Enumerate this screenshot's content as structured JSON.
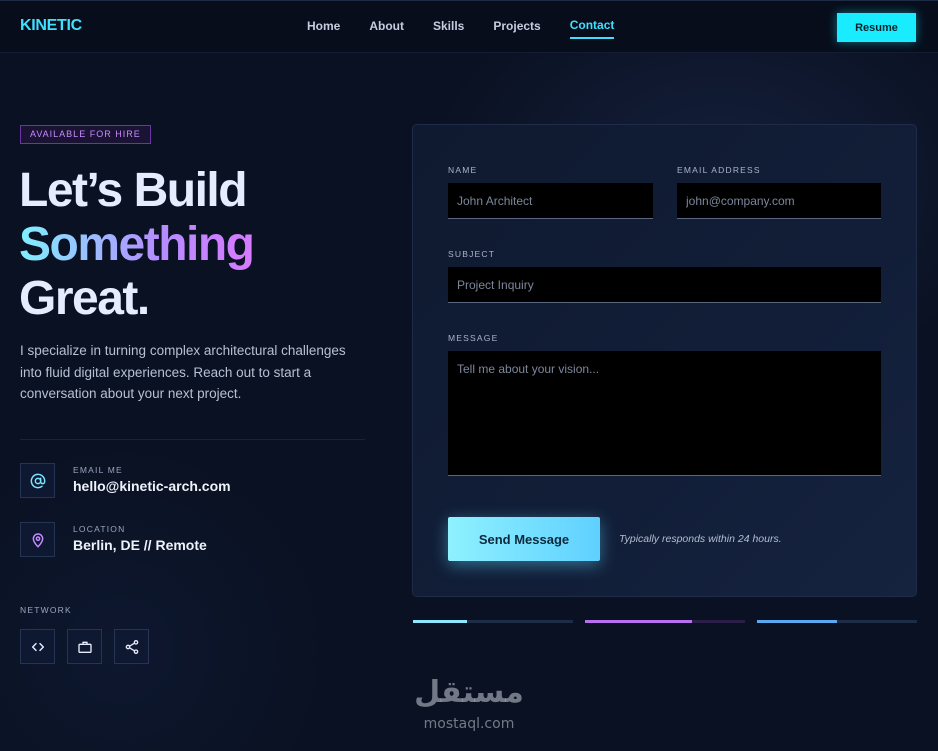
{
  "brand": {
    "logo": "KINETIC"
  },
  "nav": {
    "links": [
      "Home",
      "About",
      "Skills",
      "Projects",
      "Contact"
    ],
    "active": "Contact",
    "resume_label": "Resume"
  },
  "hero": {
    "badge": "AVAILABLE FOR HIRE",
    "line1": "Let’s Build",
    "line2": "Something",
    "line3": "Great.",
    "intro": "I specialize in turning complex architectural challenges into fluid digital experiences. Reach out to start a conversation about your next project."
  },
  "contact": {
    "email": {
      "label": "EMAIL ME",
      "value": "hello@kinetic-arch.com",
      "icon": "at-icon"
    },
    "location": {
      "label": "LOCATION",
      "value": "Berlin, DE // Remote",
      "icon": "map-pin-icon"
    },
    "network_label": "NETWORK",
    "social_icons": [
      "code-icon",
      "briefcase-icon",
      "share-icon"
    ]
  },
  "form": {
    "name": {
      "label": "NAME",
      "placeholder": "John Architect"
    },
    "email": {
      "label": "EMAIL ADDRESS",
      "placeholder": "john@company.com"
    },
    "subject": {
      "label": "SUBJECT",
      "placeholder": "Project Inquiry"
    },
    "message": {
      "label": "MESSAGE",
      "placeholder": "Tell me about your vision..."
    },
    "submit_label": "Send Message",
    "note": "Typically responds within 24 hours."
  },
  "progress_bars": [
    {
      "fraction": 0.34,
      "color": "#8fe6ff",
      "track": "#1e2c45"
    },
    {
      "fraction": 0.67,
      "color": "#b86ff0",
      "track": "#2a1e48"
    },
    {
      "fraction": 0.5,
      "color": "#5aa8f0",
      "track": "#1e2c45"
    }
  ],
  "colors": {
    "accent_cyan": "#19ecff",
    "accent_purple": "#c58bff",
    "background": "#0a1122"
  },
  "watermark": {
    "arabic": "مستقل",
    "latin": "mostaql.com"
  }
}
